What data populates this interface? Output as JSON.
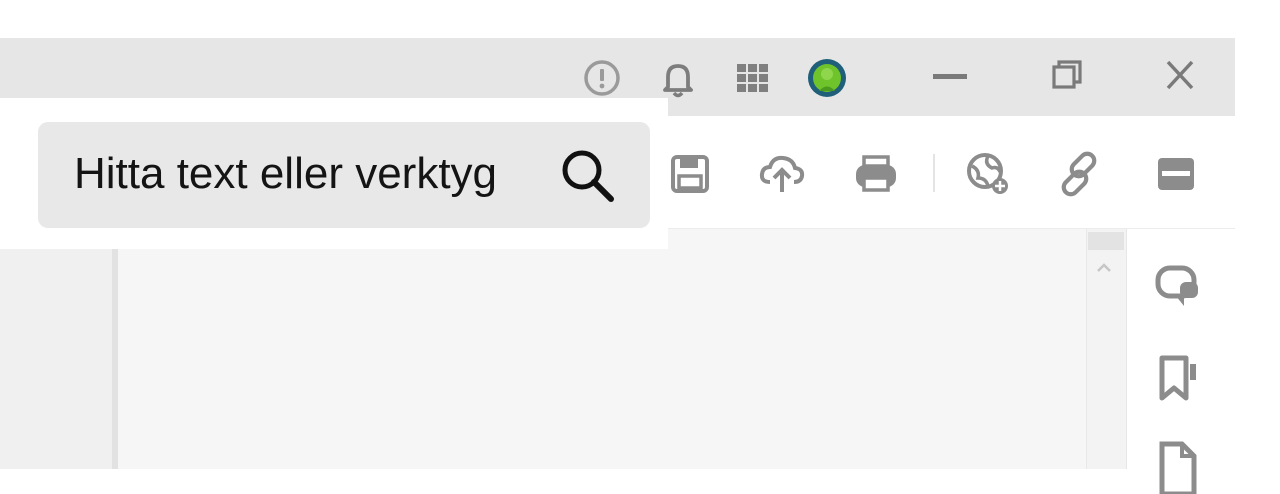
{
  "titlebar": {
    "icons": [
      "help-icon",
      "bell-icon",
      "apps-grid-icon",
      "profile-avatar"
    ],
    "window_controls": [
      "minimize-icon",
      "restore-icon",
      "close-icon"
    ]
  },
  "toolbar": {
    "icons": [
      "save-icon",
      "upload-cloud-icon",
      "print-icon",
      "globe-share-icon",
      "link-icon",
      "mail-icon"
    ]
  },
  "search": {
    "placeholder": "Hitta text eller verktyg",
    "icon": "search-icon"
  },
  "right_rail": {
    "icons": [
      "comment-icon",
      "bookmark-icon",
      "page-icon"
    ]
  },
  "colors": {
    "avatar_ring": "#1f5f7a",
    "avatar_fill": "#6fc32b",
    "icon_gray": "#8a8a8a",
    "search_bg": "#e8e8e8"
  }
}
